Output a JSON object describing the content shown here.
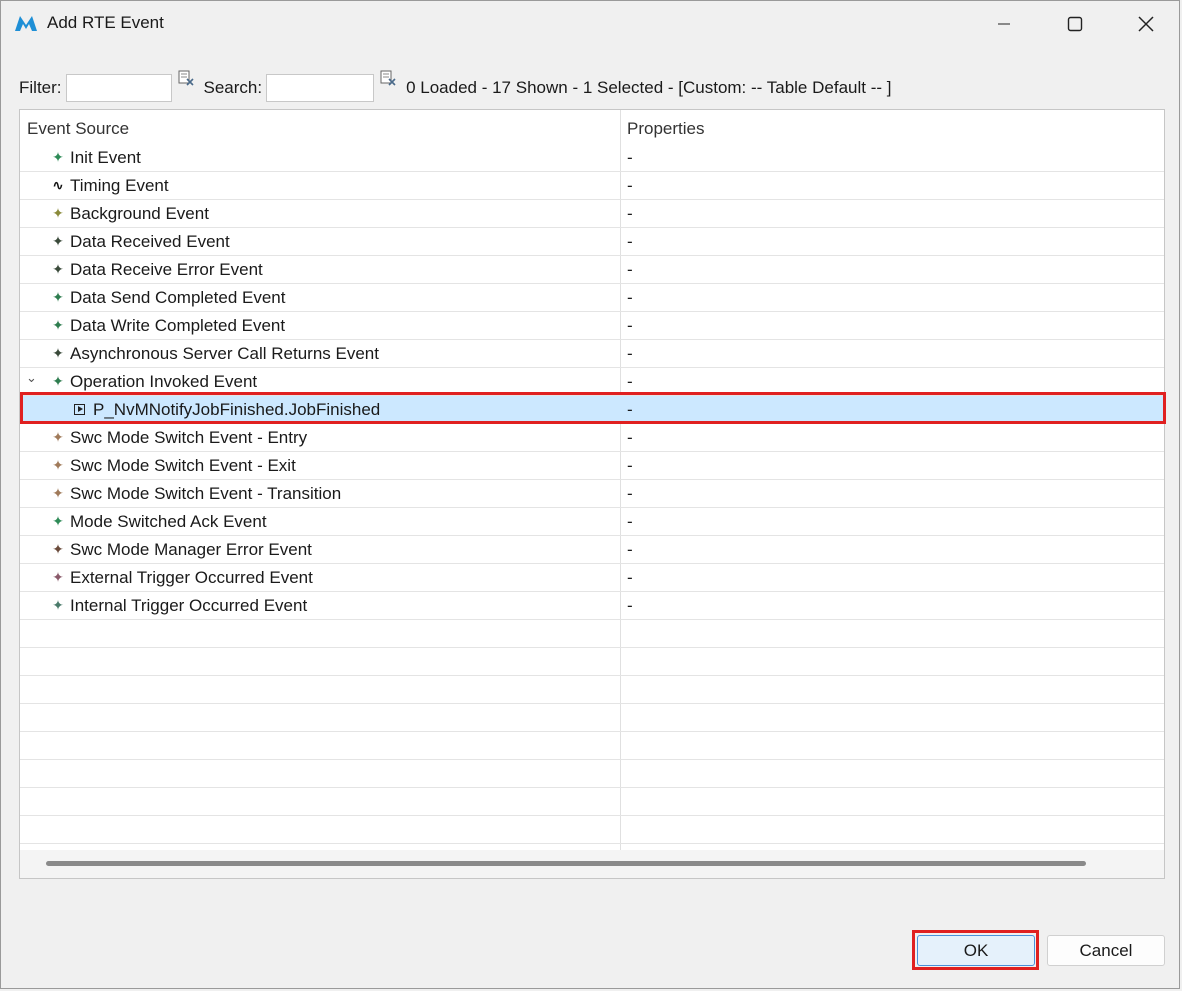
{
  "window": {
    "title": "Add RTE Event",
    "controls": {
      "minimize": "minimize",
      "maximize": "maximize",
      "close": "close"
    }
  },
  "toolbar": {
    "filter_label": "Filter:",
    "filter_value": "",
    "search_label": "Search:",
    "search_value": "",
    "status": "0 Loaded - 17 Shown - 1 Selected -  [Custom: -- Table Default -- ]"
  },
  "table": {
    "columns": [
      "Event Source",
      "Properties"
    ],
    "rows": [
      {
        "icon": "green-star-icon",
        "label": "Init Event",
        "prop": "-",
        "icon_color": "#2e8b57"
      },
      {
        "icon": "timing-wave-icon",
        "label": "Timing Event",
        "prop": "-",
        "icon_color": "#111111"
      },
      {
        "icon": "olive-star-icon",
        "label": "Background Event",
        "prop": "-",
        "icon_color": "#8a8a3a"
      },
      {
        "icon": "dark-star-icon",
        "label": "Data Received Event",
        "prop": "-",
        "icon_color": "#3a4a3a"
      },
      {
        "icon": "dark-star-icon",
        "label": "Data Receive Error Event",
        "prop": "-",
        "icon_color": "#3a4a3a"
      },
      {
        "icon": "green-star-icon",
        "label": "Data Send Completed Event",
        "prop": "-",
        "icon_color": "#2e7d4f"
      },
      {
        "icon": "green-star-icon",
        "label": "Data Write Completed Event",
        "prop": "-",
        "icon_color": "#2e7d4f"
      },
      {
        "icon": "dark-star-icon",
        "label": "Asynchronous Server Call Returns Event",
        "prop": "-",
        "icon_color": "#3a4a3a"
      },
      {
        "icon": "green-star-icon",
        "label": "Operation Invoked Event",
        "prop": "-",
        "icon_color": "#2e7d4f",
        "expander": "⌄"
      },
      {
        "icon": "runnable-play-icon",
        "label": "P_NvMNotifyJobFinished.JobFinished",
        "prop": "-",
        "selected": true,
        "child": true
      },
      {
        "icon": "tan-star-icon",
        "label": "Swc Mode Switch Event - Entry",
        "prop": "-",
        "icon_color": "#a07a5a"
      },
      {
        "icon": "tan-star-icon",
        "label": "Swc Mode Switch Event - Exit",
        "prop": "-",
        "icon_color": "#a07a5a"
      },
      {
        "icon": "tan-star-icon",
        "label": "Swc Mode Switch Event - Transition",
        "prop": "-",
        "icon_color": "#a07a5a"
      },
      {
        "icon": "green-star-icon",
        "label": "Mode Switched Ack Event",
        "prop": "-",
        "icon_color": "#2e8b57"
      },
      {
        "icon": "brown-star-icon",
        "label": "Swc Mode Manager Error Event",
        "prop": "-",
        "icon_color": "#6a4a3a"
      },
      {
        "icon": "mauve-star-icon",
        "label": "External Trigger Occurred Event",
        "prop": "-",
        "icon_color": "#8a5a6a"
      },
      {
        "icon": "teal-star-icon",
        "label": "Internal Trigger Occurred Event",
        "prop": "-",
        "icon_color": "#4a7a6a"
      }
    ],
    "empty_rows": 8
  },
  "buttons": {
    "ok": "OK",
    "cancel": "Cancel"
  },
  "colors": {
    "selection": "#cce8ff",
    "highlight": "#e02020",
    "logo": "#1e8fd6"
  }
}
